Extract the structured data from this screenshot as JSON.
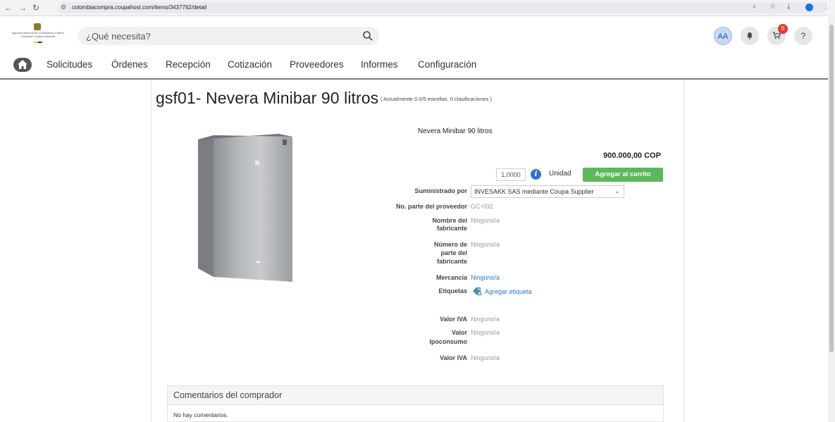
{
  "browser": {
    "url": "colombiacompra.coupahost.com/items/3437762/detail"
  },
  "header": {
    "logo_text": "Agencia Nacional de Contratación Pública Colombia Compra Eficiente",
    "search_placeholder": "¿Qué necesita?",
    "avatar_initials": "AA",
    "cart_count": "0",
    "help_label": "?"
  },
  "menu": {
    "items": [
      "Solicitudes",
      "Órdenes",
      "Recepción",
      "Cotización",
      "Proveedores",
      "Informes",
      "Configuración"
    ]
  },
  "item": {
    "title": "gsf01- Nevera Minibar 90 litros",
    "rating": "( Actualmente 0.0/5 estrellas. 0 clasificaciones )",
    "name": "Nevera Minibar 90 litros",
    "price": "900.000,00 COP",
    "quantity": "1,0000",
    "unit": "Unidad",
    "add_to_cart": "Agregar al carrito",
    "fields": {
      "supplied_by_label": "Suministrado por",
      "supplied_by_value": "INVESAKK SAS mediante Coupa Supplier",
      "supplier_part_label": "No. parte del proveedor",
      "supplier_part_value": "GC-002",
      "manufacturer_name_label_1": "Nombre del",
      "manufacturer_name_label_2": "fabricante",
      "manufacturer_name_value": "Ninguno/a",
      "manufacturer_part_label_1": "Número de",
      "manufacturer_part_label_2": "parte del",
      "manufacturer_part_label_3": "fabricante",
      "manufacturer_part_value": "Ninguno/a",
      "commodity_label": "Mercancía",
      "commodity_value": "Ninguno/a",
      "tags_label": "Etiquetas",
      "tags_value": "Agregar etiqueta",
      "iva_label": "Valor IVA",
      "iva_value": "Ninguno/a",
      "ipoconsumo_label_1": "Valor",
      "ipoconsumo_label_2": "Ipoconsumo",
      "ipoconsumo_value": "Ninguno/a",
      "iva2_label": "Valor IVA",
      "iva2_value": "Ninguno/a"
    }
  },
  "comments": {
    "title": "Comentarios del comprador",
    "empty_text": "No hay comentarios."
  }
}
